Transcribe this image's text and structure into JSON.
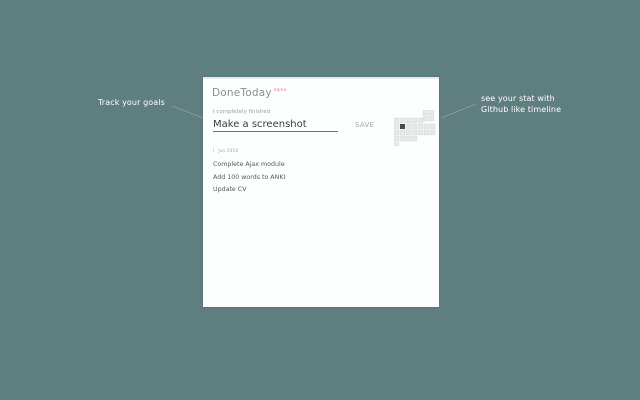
{
  "annotations": {
    "left": "Track your goals",
    "right_line1": "see your stat with",
    "right_line2": "Github like timeline"
  },
  "app": {
    "title": "DoneToday",
    "badge": "alpha"
  },
  "input": {
    "label": "I completely finished",
    "value": "Make a screenshot",
    "save_label": "SAVE"
  },
  "date_header": {
    "prefix": "I",
    "date": "Jun 2016"
  },
  "tasks": [
    {
      "label": "Complete Ajax module"
    },
    {
      "label": "Add 100 words to ANKI"
    },
    {
      "label": "Update CV"
    }
  ],
  "colors": {
    "background": "#5f7e80",
    "panel": "#fdfefe",
    "accent": "#e08aa4"
  }
}
